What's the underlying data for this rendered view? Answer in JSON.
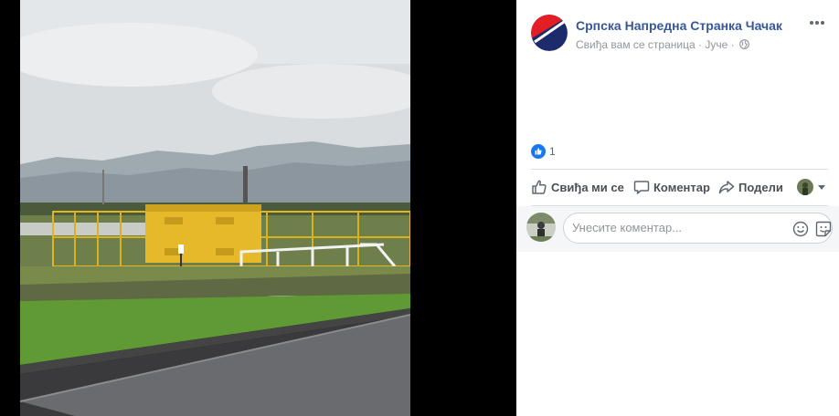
{
  "post": {
    "page_name": "Српска Напредна Странка Чачак",
    "meta_liked": "Свиђа вам се страница",
    "meta_separator": "·",
    "meta_time": "Јуче",
    "privacy_icon": "globe-icon",
    "more_icon": "more-options-icon"
  },
  "reactions": {
    "icon": "like-badge-icon",
    "count": "1"
  },
  "actions": {
    "like_label": "Свиђа ми се",
    "comment_label": "Коментар",
    "share_label": "Подели"
  },
  "comment": {
    "placeholder": "Унесите коментар...",
    "emoji_icon": "emoji-icon",
    "sticker_icon": "sticker-icon"
  },
  "colors": {
    "link_blue": "#365899",
    "like_blue": "#1877f2",
    "meta_gray": "#90949c",
    "action_gray": "#4b4f56",
    "logo_red": "#e31e24",
    "logo_navy": "#1d2a6b"
  }
}
